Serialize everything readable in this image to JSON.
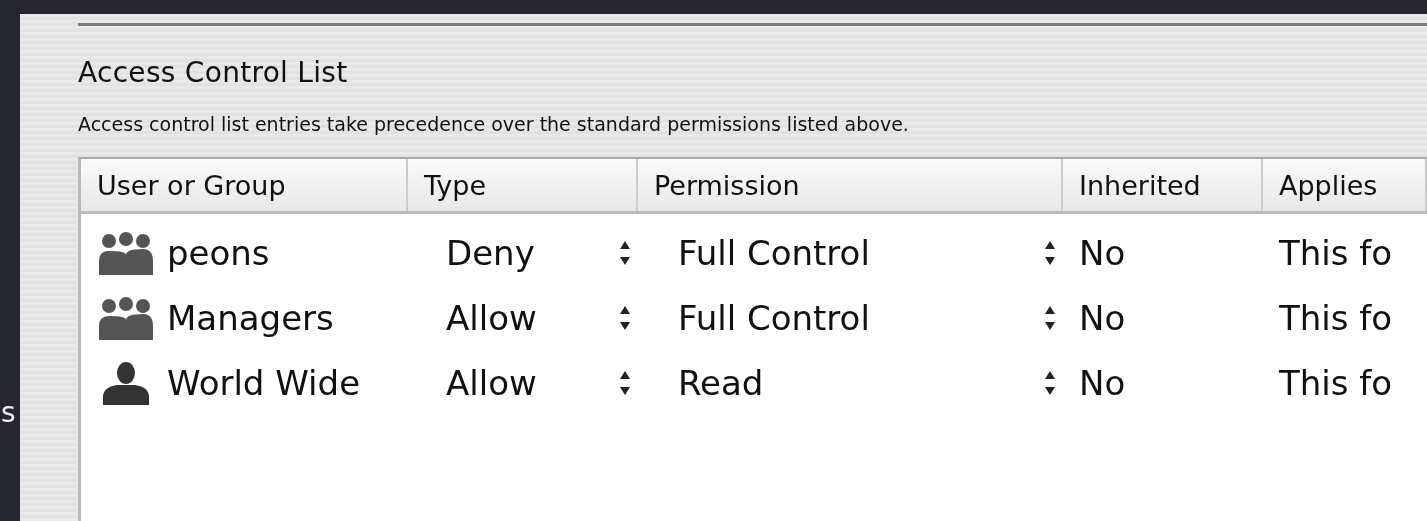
{
  "background_text": "s",
  "section": {
    "title": "Access Control List",
    "description": "Access control list entries take precedence over the standard permissions listed above."
  },
  "table": {
    "columns": [
      "User or Group",
      "Type",
      "Permission",
      "Inherited",
      "Applies"
    ],
    "rows": [
      {
        "kind": "group",
        "name": "peons",
        "type": "Deny",
        "permission": "Full Control",
        "inherited": "No",
        "applies_to": "This fo"
      },
      {
        "kind": "group",
        "name": "Managers",
        "type": "Allow",
        "permission": "Full Control",
        "inherited": "No",
        "applies_to": "This fo"
      },
      {
        "kind": "user",
        "name": "World Wide",
        "type": "Allow",
        "permission": "Read",
        "inherited": "No",
        "applies_to": "This fo"
      }
    ]
  }
}
